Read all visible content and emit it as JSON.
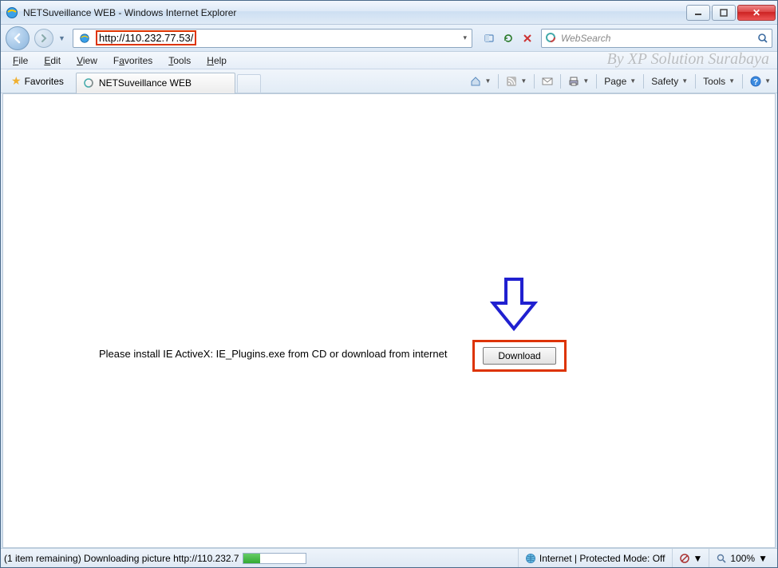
{
  "window": {
    "title": "NETSuveillance WEB - Windows Internet Explorer",
    "faded_suffix": ""
  },
  "address": {
    "url": "http://110.232.77.53/"
  },
  "search": {
    "placeholder": "WebSearch"
  },
  "menu": {
    "file": "File",
    "edit": "Edit",
    "view": "View",
    "favorites": "Favorites",
    "tools": "Tools",
    "help": "Help"
  },
  "watermark": "By XP Solution Surabaya",
  "favorites_label": "Favorites",
  "tab": {
    "title": "NETSuveillance WEB"
  },
  "cmd": {
    "page": "Page",
    "safety": "Safety",
    "tools": "Tools"
  },
  "page": {
    "message": "Please install IE ActiveX: IE_Plugins.exe from CD or download from internet",
    "download": "Download"
  },
  "status": {
    "text": "(1 item remaining) Downloading picture http://110.232.7",
    "zone": "Internet | Protected Mode: Off",
    "zoom": "100%"
  }
}
